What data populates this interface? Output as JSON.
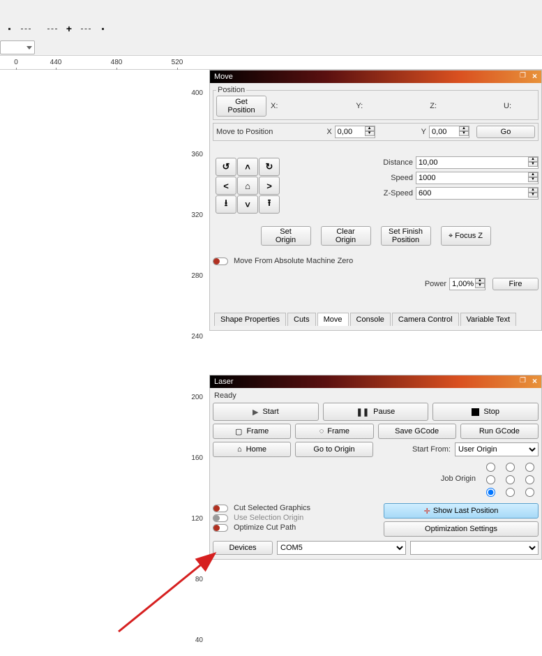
{
  "ruler_h": {
    "v0": "0",
    "v440": "440",
    "v480": "480",
    "v520": "520"
  },
  "ruler_v": {
    "v400": "400",
    "v360": "360",
    "v320": "320",
    "v280": "280",
    "v240": "240",
    "v200": "200",
    "v160": "160",
    "v120": "120",
    "v80": "80",
    "v40": "40"
  },
  "move_panel": {
    "title": "Move",
    "position_group": "Position",
    "get_position": "Get Position",
    "x_label": "X:",
    "y_label": "Y:",
    "z_label": "Z:",
    "u_label": "U:",
    "move_to_position": "Move to Position",
    "mtp_x_label": "X",
    "mtp_x": "0,00",
    "mtp_y_label": "Y",
    "mtp_y": "0,00",
    "go": "Go",
    "distance_label": "Distance",
    "distance": "10,00",
    "speed_label": "Speed",
    "speed": "1000",
    "zspeed_label": "Z-Speed",
    "zspeed": "600",
    "set_origin_l1": "Set",
    "set_origin_l2": "Origin",
    "clear_origin_l1": "Clear",
    "clear_origin_l2": "Origin",
    "set_finish_l1": "Set Finish",
    "set_finish_l2": "Position",
    "focus_z": "Focus Z",
    "move_abs_zero": "Move From Absolute Machine Zero",
    "power_label": "Power",
    "power": "1,00%",
    "fire": "Fire"
  },
  "move_tabs": {
    "shape": "Shape Properties",
    "cuts": "Cuts",
    "move": "Move",
    "console": "Console",
    "camera": "Camera Control",
    "variable": "Variable Text"
  },
  "laser_panel": {
    "title": "Laser",
    "status": "Ready",
    "start": "Start",
    "pause": "Pause",
    "stop": "Stop",
    "frame1": "Frame",
    "frame2": "Frame",
    "save_gcode": "Save GCode",
    "run_gcode": "Run GCode",
    "home": "Home",
    "goto_origin": "Go to Origin",
    "start_from_label": "Start From:",
    "start_from_value": "User Origin",
    "job_origin_label": "Job Origin",
    "cut_selected": "Cut Selected Graphics",
    "use_selection_origin": "Use Selection Origin",
    "optimize_cut_path": "Optimize Cut Path",
    "show_last_position": "Show Last Position",
    "optimization_settings": "Optimization Settings",
    "devices": "Devices",
    "port": "COM5"
  }
}
